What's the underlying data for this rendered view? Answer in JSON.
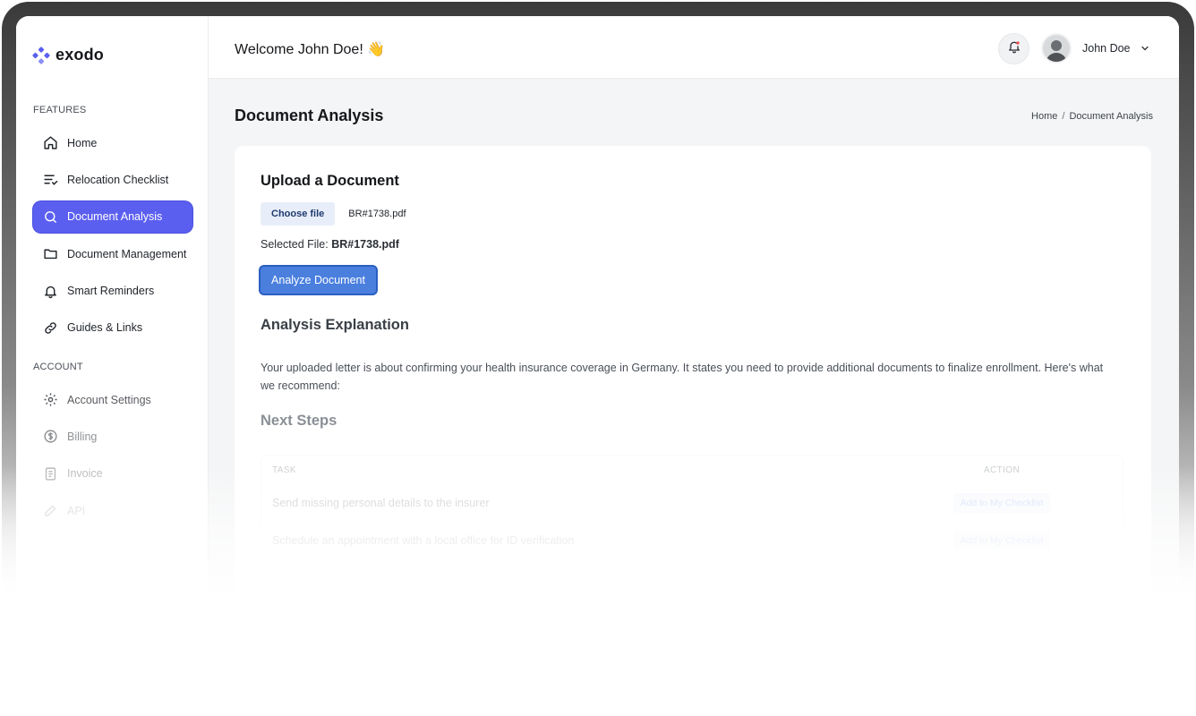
{
  "brand": {
    "name": "exodo",
    "accent": "#5b5ff0"
  },
  "sidebar": {
    "features_label": "FEATURES",
    "features": [
      {
        "label": "Home",
        "icon": "home-icon"
      },
      {
        "label": "Relocation Checklist",
        "icon": "checklist-icon"
      },
      {
        "label": "Document Analysis",
        "icon": "search-icon",
        "active": true
      },
      {
        "label": "Document Management",
        "icon": "folder-icon"
      },
      {
        "label": "Smart Reminders",
        "icon": "bell-icon"
      },
      {
        "label": "Guides & Links",
        "icon": "link-icon"
      }
    ],
    "account_label": "ACCOUNT",
    "account": [
      {
        "label": "Account Settings",
        "icon": "gear-icon"
      },
      {
        "label": "Billing",
        "icon": "dollar-icon"
      },
      {
        "label": "Invoice",
        "icon": "document-icon"
      },
      {
        "label": "API",
        "icon": "edit-icon"
      }
    ]
  },
  "header": {
    "welcome": "Welcome John Doe! 👋",
    "user_name": "John Doe"
  },
  "page": {
    "title": "Document Analysis",
    "breadcrumb": {
      "home": "Home",
      "separator": "/",
      "current": "Document Analysis"
    }
  },
  "upload": {
    "heading": "Upload a Document",
    "choose_label": "Choose file",
    "file_name": "BR#1738.pdf",
    "selected_prefix": "Selected File: ",
    "selected_file": "BR#1738.pdf",
    "analyze_label": "Analyze Document"
  },
  "analysis": {
    "heading": "Analysis Explanation",
    "text": "Your uploaded letter is about confirming your health insurance coverage in Germany. It states you need to provide additional documents to finalize enrollment. Here's what we recommend:",
    "next_steps_heading": "Next Steps",
    "table": {
      "columns": [
        "TASK",
        "ACTION"
      ],
      "rows": [
        {
          "task": "Send missing personal details to the insurer",
          "action": "Add to My Checklist"
        },
        {
          "task": "Schedule an appointment with a local office for ID verification",
          "action": "Add to My Checklist"
        }
      ]
    }
  }
}
